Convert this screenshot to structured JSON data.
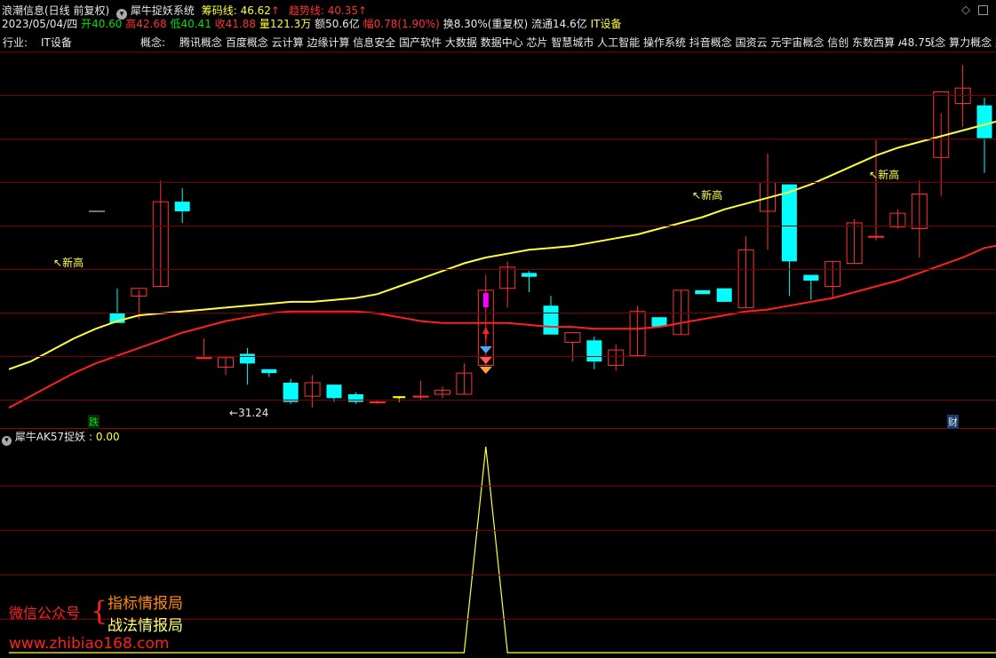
{
  "header": {
    "stock_name": "浪潮信息(日线 前复权)",
    "indicator_name": "犀牛捉妖系统",
    "chip_label": "筹码线:",
    "chip_value": "46.62",
    "trend_label": "趋势线:",
    "trend_value": "40.35",
    "up_arrow": "↑",
    "settings_icon": "chevron-down-icon",
    "corner_icons": [
      "diamond-icon",
      "maximize-icon"
    ]
  },
  "quote": {
    "date": "2023/05/04/四",
    "open_label": "开",
    "open": "40.60",
    "high_label": "高",
    "high": "42.68",
    "low_label": "低",
    "low": "40.41",
    "close_label": "收",
    "close": "41.88",
    "volume_label": "量",
    "volume": "121.3万",
    "amount_label": "额",
    "amount": "50.6亿",
    "change_label": "幅",
    "change": "0.78(1.90%)",
    "turnover": "换8.30%(重复权)",
    "float": "流通14.6亿",
    "sector": "IT设备"
  },
  "info_bar": {
    "industry_label": "行业:",
    "industry": "IT设备",
    "concept_label": "概念:",
    "concepts": "腾讯概念 百度概念 云计算 边缘计算 信息安全 国产软件 大数据 数据中心 芯片 智慧城市 人工智能 操作系统 抖音概念 国资云 元宇宙概念 信创 东数西算 AIGC概念 算力概念 英"
  },
  "annotations": {
    "new_high": "新高",
    "low_value": "31.24",
    "peak_value": "48.75",
    "marker_die": "跌",
    "marker_cai": "财"
  },
  "sub_panel": {
    "title": "犀牛AK57捉妖",
    "value_label": ": 0.00"
  },
  "watermark": {
    "wechat_label": "微信公众号",
    "line1": "指标情报局",
    "line2": "战法情报局",
    "url": "www.zhibiao168.com"
  },
  "colors": {
    "background": "#000000",
    "up": "#ff3232",
    "down": "#00ffff",
    "chip_line": "#ffff3c",
    "trend_line": "#ff2020",
    "grid": "#7a0000",
    "signal": "#ff00ff",
    "watermark_orange": "#ff8c00",
    "watermark_yellow": "#ffff66",
    "watermark_red": "#ff2020"
  },
  "chart_data": {
    "type": "candlestick",
    "candles": [
      {
        "o": 35.9,
        "h": 37.2,
        "l": 35.4,
        "c": 35.4
      },
      {
        "o": 36.8,
        "h": 37.1,
        "l": 35.6,
        "c": 37.2
      },
      {
        "o": 37.3,
        "h": 42.8,
        "l": 37.3,
        "c": 41.7
      },
      {
        "o": 41.7,
        "h": 42.4,
        "l": 40.6,
        "c": 41.2
      },
      {
        "o": 33.6,
        "h": 34.6,
        "l": 33.6,
        "c": 33.6
      },
      {
        "o": 33.1,
        "h": 33.6,
        "l": 32.7,
        "c": 33.6
      },
      {
        "o": 33.8,
        "h": 34.1,
        "l": 32.2,
        "c": 33.3
      },
      {
        "o": 33.0,
        "h": 33.0,
        "l": 32.6,
        "c": 32.8
      },
      {
        "o": 32.3,
        "h": 32.5,
        "l": 31.2,
        "c": 31.3
      },
      {
        "o": 31.6,
        "h": 32.7,
        "l": 31.0,
        "c": 32.3
      },
      {
        "o": 32.2,
        "h": 32.2,
        "l": 31.3,
        "c": 31.5
      },
      {
        "o": 31.7,
        "h": 31.8,
        "l": 31.2,
        "c": 31.3
      },
      {
        "o": 31.3,
        "h": 31.4,
        "l": 31.2,
        "c": 31.3
      },
      {
        "o": 31.5,
        "h": 31.6,
        "l": 31.3,
        "c": 31.6
      },
      {
        "o": 31.6,
        "h": 32.4,
        "l": 31.4,
        "c": 31.6
      },
      {
        "o": 31.7,
        "h": 32.1,
        "l": 31.5,
        "c": 31.9
      },
      {
        "o": 31.7,
        "h": 33.3,
        "l": 31.7,
        "c": 32.8
      },
      {
        "o": 33.2,
        "h": 37.9,
        "l": 33.2,
        "c": 37.1
      },
      {
        "o": 37.2,
        "h": 38.6,
        "l": 36.2,
        "c": 38.3
      },
      {
        "o": 38.0,
        "h": 38.1,
        "l": 37.0,
        "c": 37.8
      },
      {
        "o": 36.3,
        "h": 36.8,
        "l": 35.5,
        "c": 34.8
      },
      {
        "o": 34.4,
        "h": 34.4,
        "l": 33.4,
        "c": 34.9
      },
      {
        "o": 34.5,
        "h": 34.7,
        "l": 33.0,
        "c": 33.4
      },
      {
        "o": 33.2,
        "h": 34.3,
        "l": 32.9,
        "c": 34.0
      },
      {
        "o": 33.7,
        "h": 36.3,
        "l": 33.7,
        "c": 36.0
      },
      {
        "o": 35.7,
        "h": 35.7,
        "l": 35.2,
        "c": 35.2
      },
      {
        "o": 34.8,
        "h": 37.1,
        "l": 34.8,
        "c": 37.1
      },
      {
        "o": 37.1,
        "h": 37.1,
        "l": 36.9,
        "c": 36.9
      },
      {
        "o": 37.2,
        "h": 37.2,
        "l": 36.5,
        "c": 36.5
      },
      {
        "o": 36.2,
        "h": 39.9,
        "l": 36.2,
        "c": 39.2
      },
      {
        "o": 41.2,
        "h": 44.2,
        "l": 39.2,
        "c": 42.7
      },
      {
        "o": 42.6,
        "h": 42.6,
        "l": 36.8,
        "c": 38.6
      },
      {
        "o": 37.9,
        "h": 37.9,
        "l": 36.6,
        "c": 37.6
      },
      {
        "o": 37.3,
        "h": 38.6,
        "l": 36.7,
        "c": 38.6
      },
      {
        "o": 38.5,
        "h": 40.8,
        "l": 38.5,
        "c": 40.6
      },
      {
        "o": 39.9,
        "h": 44.9,
        "l": 39.7,
        "c": 39.9
      },
      {
        "o": 40.4,
        "h": 41.3,
        "l": 40.3,
        "c": 41.1
      },
      {
        "o": 40.3,
        "h": 42.8,
        "l": 38.8,
        "c": 42.1
      },
      {
        "o": 44.0,
        "h": 46.3,
        "l": 42.0,
        "c": 47.4
      },
      {
        "o": 46.8,
        "h": 48.8,
        "l": 45.6,
        "c": 47.6
      },
      {
        "o": 46.7,
        "h": 47.1,
        "l": 43.2,
        "c": 45.0
      },
      {
        "o": 42.6,
        "h": 44.0,
        "l": 40.0,
        "c": 41.2
      },
      {
        "o": 36.8,
        "h": 40.8,
        "l": 36.0,
        "c": 38.2
      },
      {
        "o": 40.6,
        "h": 42.7,
        "l": 40.4,
        "c": 41.9
      }
    ],
    "hidden_count": 5,
    "chip_line": [
      33.0,
      33.4,
      34.0,
      34.6,
      35.1,
      35.5,
      35.8,
      35.9,
      36.0,
      36.1,
      36.2,
      36.3,
      36.4,
      36.5,
      36.5,
      36.6,
      36.7,
      36.9,
      37.3,
      37.7,
      38.1,
      38.5,
      38.8,
      39.0,
      39.2,
      39.3,
      39.4,
      39.6,
      39.8,
      40.0,
      40.3,
      40.6,
      40.9,
      41.3,
      41.6,
      41.9,
      42.2,
      42.6,
      43.1,
      43.6,
      44.1,
      44.5,
      44.8,
      45.1,
      45.4,
      45.7,
      46.0,
      46.4,
      46.7
    ],
    "trend_line": [
      31.0,
      31.6,
      32.2,
      32.8,
      33.3,
      33.7,
      34.1,
      34.5,
      34.9,
      35.2,
      35.5,
      35.7,
      35.9,
      36.0,
      36.0,
      36.0,
      36.0,
      35.9,
      35.7,
      35.5,
      35.4,
      35.4,
      35.4,
      35.4,
      35.3,
      35.2,
      35.2,
      35.1,
      35.1,
      35.1,
      35.2,
      35.4,
      35.6,
      35.8,
      36.0,
      36.1,
      36.3,
      36.5,
      36.7,
      37.0,
      37.3,
      37.6,
      38.0,
      38.4,
      38.8,
      39.3,
      39.5,
      39.8,
      40.3
    ],
    "ylim": [
      30.5,
      49.5
    ],
    "indicator": {
      "name": "犀牛AK57捉妖",
      "values": [
        0,
        0,
        0,
        0,
        0,
        0,
        0,
        0,
        0,
        0,
        0,
        0,
        0,
        0,
        0,
        0,
        0,
        0,
        0,
        0,
        0,
        0,
        1,
        0,
        0,
        0,
        0,
        0,
        0,
        0,
        0,
        0,
        0,
        0,
        0,
        0,
        0,
        0,
        0,
        0,
        0,
        0,
        0,
        0,
        0,
        0,
        0,
        0,
        0
      ],
      "ylim": [
        0,
        1
      ]
    }
  }
}
